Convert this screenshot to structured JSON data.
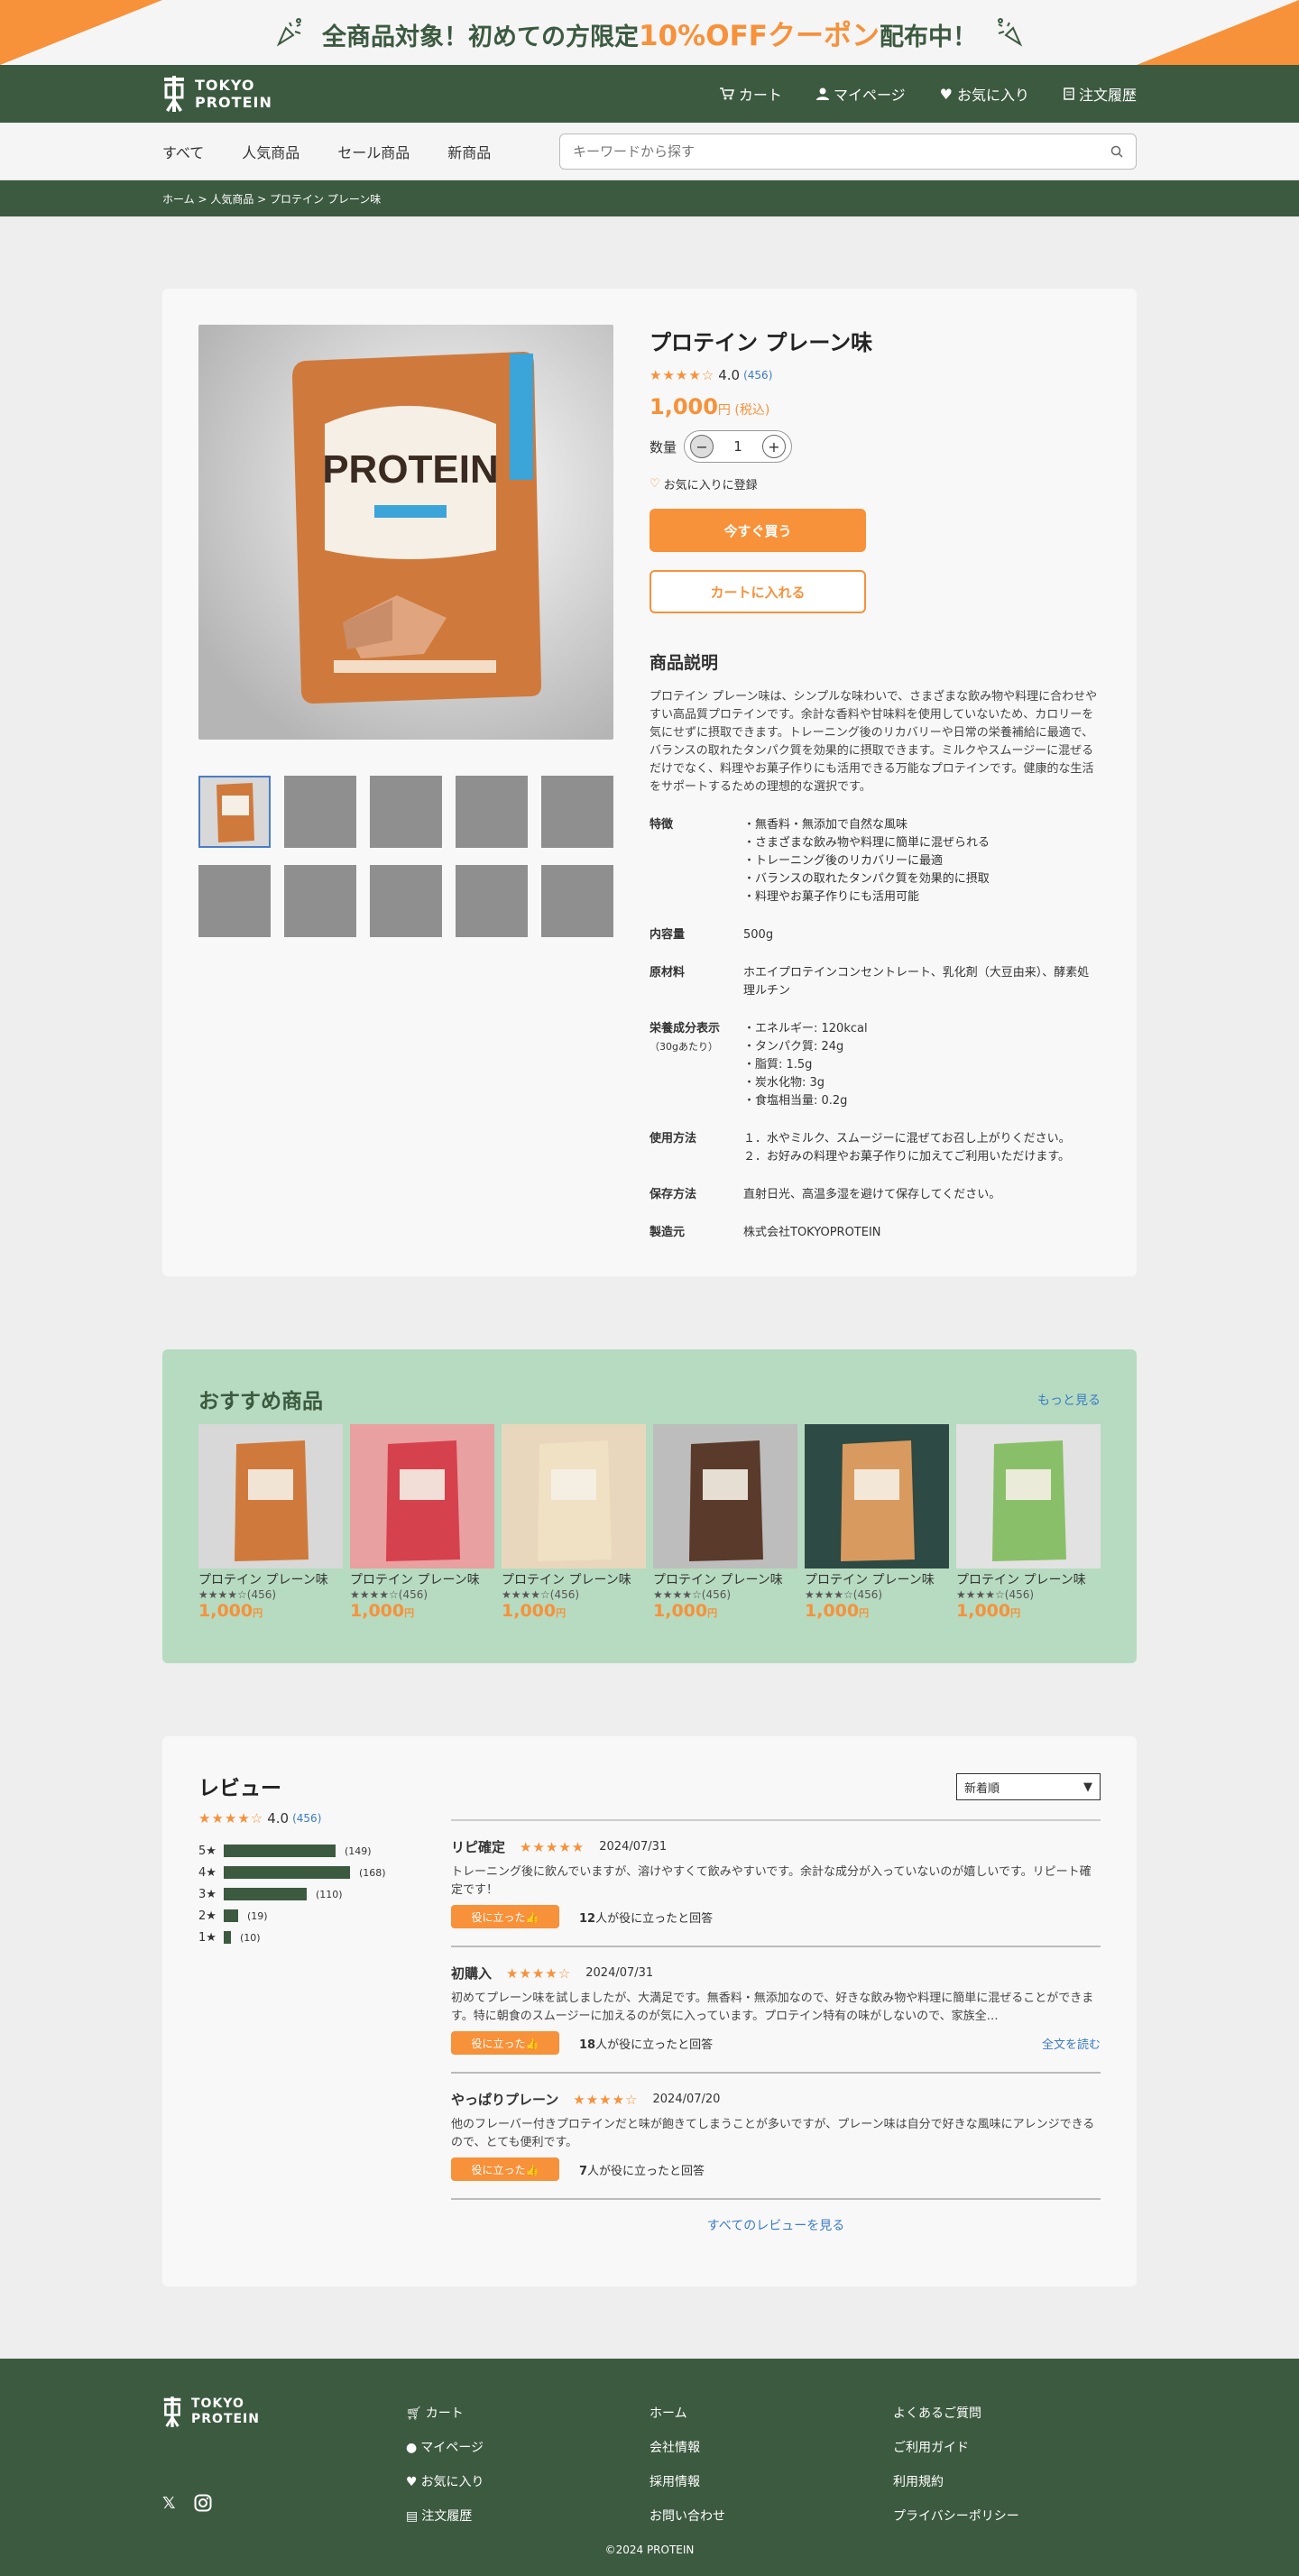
{
  "promo": {
    "pre": "全商品対象！初めての方限定",
    "hi": "10%OFFクーポン",
    "post": "配布中！"
  },
  "header": {
    "logo_line1": "TOKYO",
    "logo_line2": "PROTEIN",
    "nav": [
      "カート",
      "マイページ",
      "お気に入り",
      "注文履歴"
    ]
  },
  "categories": [
    "すべて",
    "人気商品",
    "セール商品",
    "新商品"
  ],
  "search": {
    "placeholder": "キーワードから探す"
  },
  "breadcrumb": "ホーム > 人気商品 > プロテイン プレーン味",
  "product": {
    "title": "プロテイン プレーン味",
    "stars": "★★★★☆",
    "rating": "4.0",
    "count": "(456)",
    "price": "1,000",
    "price_unit": "円 (税込)",
    "qty_label": "数量",
    "qty": "1",
    "fav": "お気に入りに登録",
    "buy_now": "今すぐ買う",
    "add_cart": "カートに入れる",
    "desc_title": "商品説明",
    "desc": "プロテイン プレーン味は、シンプルな味わいで、さまざまな飲み物や料理に合わせやすい高品質プロテインです。余計な香料や甘味料を使用していないため、カロリーを気にせずに摂取できます。トレーニング後のリカバリーや日常の栄養補給に最適で、バランスの取れたタンパク質を効果的に摂取できます。ミルクやスムージーに混ぜるだけでなく、料理やお菓子作りにも活用できる万能なプロテインです。健康的な生活をサポートするための理想的な選択です。",
    "specs": [
      {
        "k": "特徴",
        "sub": "",
        "v": [
          "・無香料・無添加で自然な風味",
          "・さまざまな飲み物や料理に簡単に混ぜられる",
          "・トレーニング後のリカバリーに最適",
          "・バランスの取れたタンパク質を効果的に摂取",
          "・料理やお菓子作りにも活用可能"
        ]
      },
      {
        "k": "内容量",
        "sub": "",
        "v": [
          "500g"
        ]
      },
      {
        "k": "原材料",
        "sub": "",
        "v": [
          "ホエイプロテインコンセントレート、乳化剤（大豆由来）、酵素処理ルチン"
        ]
      },
      {
        "k": "栄養成分表示",
        "sub": "（30gあたり）",
        "v": [
          "・エネルギー: 120kcal",
          "・タンパク質: 24g",
          "・脂質: 1.5g",
          "・炭水化物: 3g",
          "・食塩相当量: 0.2g"
        ]
      },
      {
        "k": "使用方法",
        "sub": "",
        "v": [
          "１．水やミルク、スムージーに混ぜてお召し上がりください。",
          "２．お好みの料理やお菓子作りに加えてご利用いただけます。"
        ]
      },
      {
        "k": "保存方法",
        "sub": "",
        "v": [
          "直射日光、高温多湿を避けて保存してください。"
        ]
      },
      {
        "k": "製造元",
        "sub": "",
        "v": [
          "株式会社TOKYOPROTEIN"
        ]
      }
    ]
  },
  "recommend": {
    "title": "おすすめ商品",
    "more": "もっと見る",
    "items": [
      {
        "name": "プロテイン プレーン味",
        "stars": "★★★★☆",
        "count": "(456)",
        "price": "1,000",
        "unit": "円"
      },
      {
        "name": "プロテイン プレーン味",
        "stars": "★★★★☆",
        "count": "(456)",
        "price": "1,000",
        "unit": "円"
      },
      {
        "name": "プロテイン プレーン味",
        "stars": "★★★★☆",
        "count": "(456)",
        "price": "1,000",
        "unit": "円"
      },
      {
        "name": "プロテイン プレーン味",
        "stars": "★★★★☆",
        "count": "(456)",
        "price": "1,000",
        "unit": "円"
      },
      {
        "name": "プロテイン プレーン味",
        "stars": "★★★★☆",
        "count": "(456)",
        "price": "1,000",
        "unit": "円"
      },
      {
        "name": "プロテイン プレーン味",
        "stars": "★★★★☆",
        "count": "(456)",
        "price": "1,000",
        "unit": "円"
      }
    ]
  },
  "reviews": {
    "title": "レビュー",
    "sort": "新着順",
    "stars": "★★★★☆",
    "avg": "4.0",
    "count": "(456)",
    "dist": [
      {
        "label": "5★",
        "n": 149,
        "c": "(149)"
      },
      {
        "label": "4★",
        "n": 168,
        "c": "(168)"
      },
      {
        "label": "3★",
        "n": 110,
        "c": "(110)"
      },
      {
        "label": "2★",
        "n": 19,
        "c": "(19)"
      },
      {
        "label": "1★",
        "n": 10,
        "c": "(10)"
      }
    ],
    "items": [
      {
        "name": "リピ確定",
        "stars": "★★★★★",
        "date": "2024/07/31",
        "body": "トレーニング後に飲んでいますが、溶けやすくて飲みやすいです。余計な成分が入っていないのが嬉しいです。リピート確定です！",
        "help": "役に立った👍",
        "hn": "12",
        "htxt": "人が役に立ったと回答",
        "readall": ""
      },
      {
        "name": "初購入",
        "stars": "★★★★☆",
        "date": "2024/07/31",
        "body": "初めてプレーン味を試しましたが、大満足です。無香料・無添加なので、好きな飲み物や料理に簡単に混ぜることができます。特に朝食のスムージーに加えるのが気に入っています。プロテイン特有の味がしないので、家族全…",
        "help": "役に立った👍",
        "hn": "18",
        "htxt": "人が役に立ったと回答",
        "readall": "全文を読む"
      },
      {
        "name": "やっぱりプレーン",
        "stars": "★★★★☆",
        "date": "2024/07/20",
        "body": "他のフレーバー付きプロテインだと味が飽きてしまうことが多いですが、プレーン味は自分で好きな風味にアレンジできるので、とても便利です。",
        "help": "役に立った👍",
        "hn": "7",
        "htxt": "人が役に立ったと回答",
        "readall": ""
      }
    ],
    "all": "すべてのレビューを見る"
  },
  "footer": {
    "col1": [
      "カート",
      "マイページ",
      "お気に入り",
      "注文履歴"
    ],
    "col2": [
      "ホーム",
      "会社情報",
      "採用情報",
      "お問い合わせ"
    ],
    "col3": [
      "よくあるご質問",
      "ご利用ガイド",
      "利用規約",
      "プライバシーポリシー"
    ],
    "copy": "©2024 PROTEIN"
  }
}
